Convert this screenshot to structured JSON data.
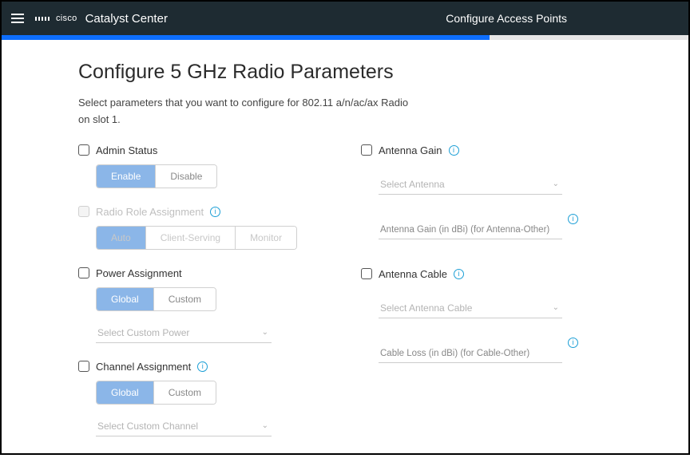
{
  "header": {
    "brand_small": "cisco",
    "brand": "Catalyst Center",
    "page_title": "Configure Access Points"
  },
  "main": {
    "title": "Configure 5 GHz Radio Parameters",
    "description": "Select parameters that you want to configure for 802.11 a/n/ac/ax Radio on slot 1."
  },
  "left": {
    "admin_status": {
      "label": "Admin Status",
      "opts": [
        "Enable",
        "Disable"
      ]
    },
    "radio_role": {
      "label": "Radio Role Assignment",
      "opts": [
        "Auto",
        "Client-Serving",
        "Monitor"
      ]
    },
    "power": {
      "label": "Power Assignment",
      "opts": [
        "Global",
        "Custom"
      ],
      "select_placeholder": "Select Custom Power"
    },
    "channel": {
      "label": "Channel Assignment",
      "opts": [
        "Global",
        "Custom"
      ],
      "select_placeholder": "Select Custom Channel"
    }
  },
  "right": {
    "antenna_gain": {
      "label": "Antenna Gain",
      "select_placeholder": "Select Antenna",
      "input_placeholder": "Antenna Gain (in dBi) (for Antenna-Other)"
    },
    "antenna_cable": {
      "label": "Antenna Cable",
      "select_placeholder": "Select Antenna Cable",
      "input_placeholder": "Cable Loss (in dBi) (for Cable-Other)"
    }
  }
}
